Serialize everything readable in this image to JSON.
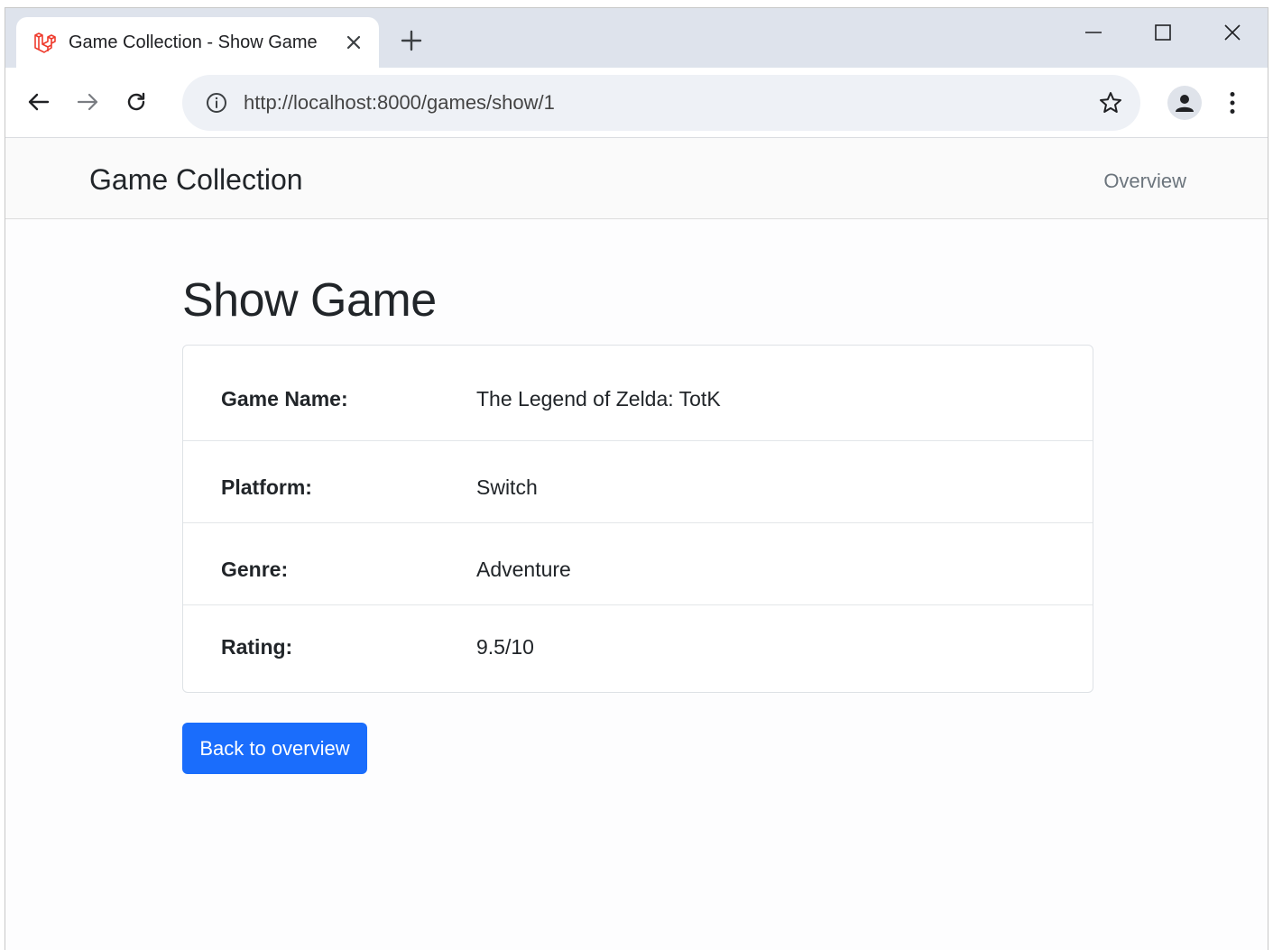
{
  "browser": {
    "tab_title": "Game Collection - Show Game",
    "url": "http://localhost:8000/games/show/1",
    "favicon": "laravel-logo-icon",
    "accent_color": "#ef3b2d"
  },
  "site": {
    "brand": "Game Collection",
    "nav_link": "Overview"
  },
  "main": {
    "heading": "Show Game",
    "details": [
      {
        "label": "Game Name:",
        "value": "The Legend of Zelda: TotK"
      },
      {
        "label": "Platform:",
        "value": "Switch"
      },
      {
        "label": "Genre:",
        "value": "Adventure"
      },
      {
        "label": "Rating:",
        "value": "9.5/10"
      }
    ],
    "back_button": "Back to overview",
    "button_color": "#1a6dfc"
  }
}
